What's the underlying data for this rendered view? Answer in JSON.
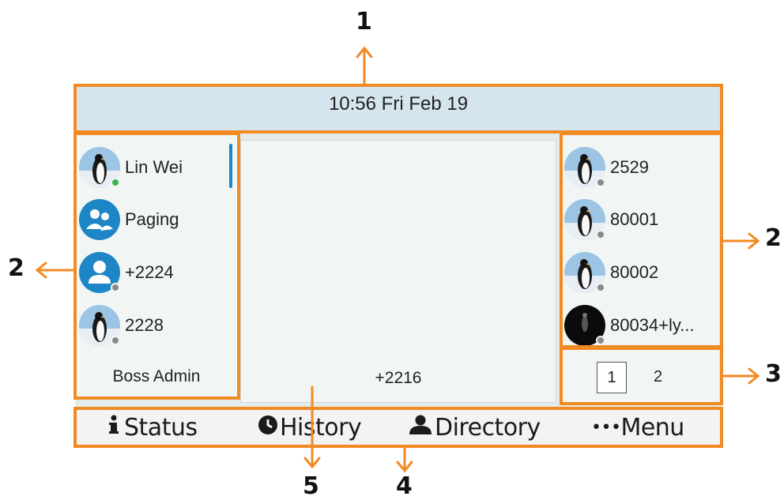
{
  "callouts": {
    "n1": "1",
    "n2_left": "2",
    "n2_right": "2",
    "n3": "3",
    "n4": "4",
    "n5": "5"
  },
  "status_bar": {
    "time": "10:56 Fri Feb 19"
  },
  "left_accounts": [
    {
      "label": "Lin Wei",
      "avatar": "penguin-avatar",
      "presence": "online"
    },
    {
      "label": "Paging",
      "avatar": "group-icon",
      "presence": ""
    },
    {
      "label": "+2224",
      "avatar": "person-icon",
      "presence": "offline"
    },
    {
      "label": "2228",
      "avatar": "penguin-avatar",
      "presence": "offline"
    }
  ],
  "left_footer": "Boss Admin",
  "idle_number": "+2216",
  "right_keys": [
    {
      "label": "2529",
      "avatar": "penguin-avatar",
      "presence": "offline"
    },
    {
      "label": "80001",
      "avatar": "penguin-avatar",
      "presence": "offline"
    },
    {
      "label": "80002",
      "avatar": "penguin-avatar",
      "presence": "offline"
    },
    {
      "label": "80034+ly...",
      "avatar": "dark-photo-avatar",
      "presence": "offline"
    }
  ],
  "pagination": {
    "current": "1",
    "next": "2"
  },
  "softkeys": [
    {
      "label": "Status",
      "icon": "info-icon"
    },
    {
      "label": "History",
      "icon": "clock-icon"
    },
    {
      "label": "Directory",
      "icon": "person-icon"
    },
    {
      "label": "Menu",
      "icon": "ellipsis-icon",
      "prefix": "•••"
    }
  ],
  "colors": {
    "callout_orange": "#f28a24",
    "status_bar_bg": "#d5e5ee",
    "accent_blue": "#1e86c6",
    "online_green": "#3db44a"
  }
}
